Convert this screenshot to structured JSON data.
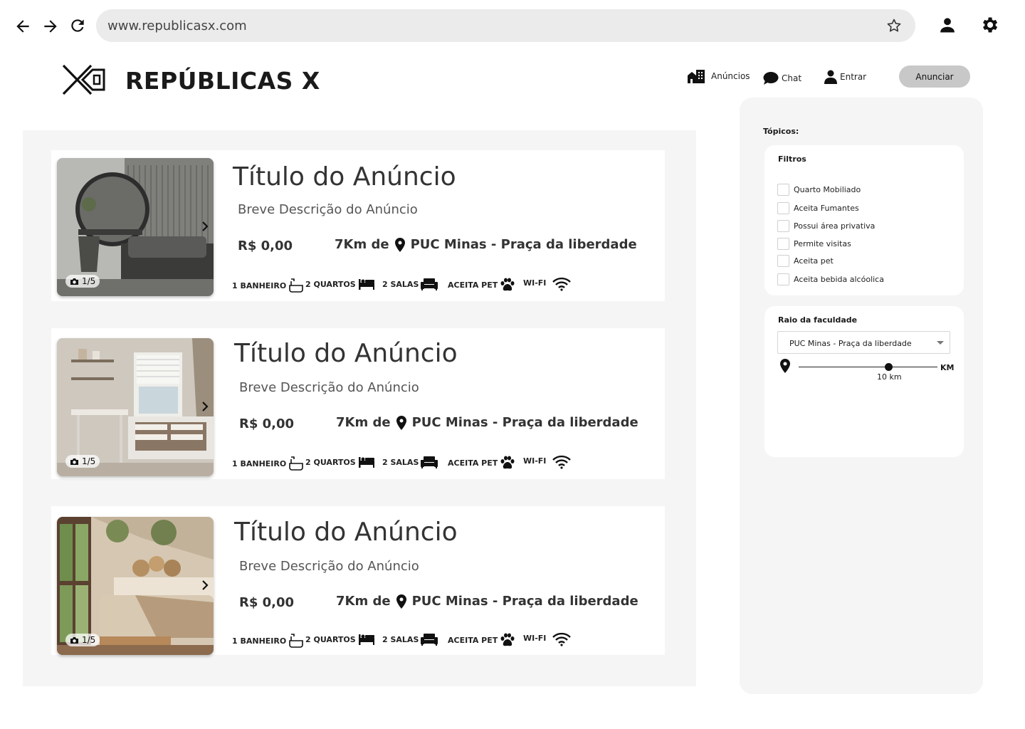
{
  "browser": {
    "url": "www.republicasx.com"
  },
  "header": {
    "brand": "REPÚBLICAS X",
    "nav": {
      "anuncios": "Anúncios",
      "chat": "Chat",
      "entrar": "Entrar"
    },
    "cta": "Anunciar"
  },
  "listings": [
    {
      "title": "Título do Anúncio",
      "description": "Breve Descrição do Anúncio",
      "price": "R$ 0,00",
      "distance": "7Km de",
      "location": "PUC Minas - Praça da liberdade",
      "photo_counter": "1/5",
      "amenities": {
        "bath": "1 BANHEIRO",
        "rooms": "2 QUARTOS",
        "living": "2 SALAS",
        "pet": "ACEITA PET",
        "wifi": "WI-FI"
      }
    },
    {
      "title": "Título do Anúncio",
      "description": "Breve Descrição do Anúncio",
      "price": "R$ 0,00",
      "distance": "7Km de",
      "location": "PUC Minas - Praça da liberdade",
      "photo_counter": "1/5",
      "amenities": {
        "bath": "1 BANHEIRO",
        "rooms": "2 QUARTOS",
        "living": "2 SALAS",
        "pet": "ACEITA PET",
        "wifi": "WI-FI"
      }
    },
    {
      "title": "Título do Anúncio",
      "description": "Breve Descrição do Anúncio",
      "price": "R$ 0,00",
      "distance": "7Km de",
      "location": "PUC Minas - Praça da liberdade",
      "photo_counter": "1/5",
      "amenities": {
        "bath": "1 BANHEIRO",
        "rooms": "2 QUARTOS",
        "living": "2 SALAS",
        "pet": "ACEITA PET",
        "wifi": "WI-FI"
      }
    }
  ],
  "sidebar": {
    "topics_label": "Tópicos:",
    "filters": {
      "title": "Filtros",
      "items": [
        "Quarto Mobiliado",
        "Aceita Fumantes",
        "Possui área privativa",
        "Permite visitas",
        "Aceita pet",
        "Aceita bebida alcóolica"
      ]
    },
    "radius": {
      "title": "Raio da faculdade",
      "selected": "PUC Minas - Praça da liberdade",
      "unit": "KM",
      "value_label": "10 km",
      "slider_fraction": 0.65
    }
  },
  "colors": {
    "panel_bg": "#f5f5f5",
    "cta_bg": "#c8c8c8",
    "url_bg": "#ebebeb"
  }
}
